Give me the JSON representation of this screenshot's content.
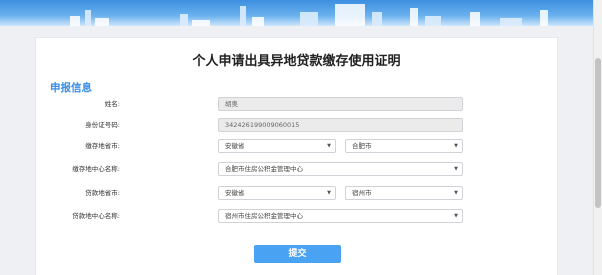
{
  "form": {
    "title": "个人申请出具异地贷款缴存使用证明",
    "section_title": "申报信息",
    "name_label": "姓名:",
    "name_value": "胡奥",
    "id_label": "身份证号码:",
    "id_value": "342426199009060015",
    "deposit_province_label": "缴存地省市:",
    "deposit_province_value": "安徽省",
    "deposit_city_value": "合肥市",
    "deposit_center_label": "缴存地中心名称:",
    "deposit_center_value": "合肥市住房公积金管理中心",
    "loan_province_label": "贷款地省市:",
    "loan_province_value": "安徽省",
    "loan_city_value": "宿州市",
    "loan_center_label": "贷款地中心名称:",
    "loan_center_value": "宿州市住房公积金管理中心",
    "submit_label": "提交"
  },
  "icons": {
    "dropdown": "caret-down-icon"
  }
}
